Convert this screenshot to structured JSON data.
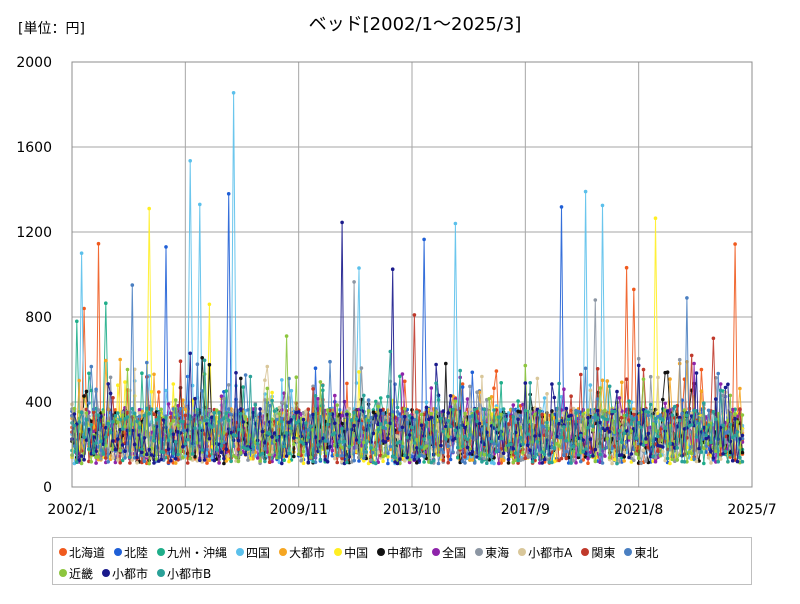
{
  "chart_data": {
    "type": "line",
    "title": "ベッド[2002/1～2025/3]",
    "unit_label": "[単位：円]",
    "ylim": [
      0,
      2000
    ],
    "yticks": [
      "0",
      "400",
      "800",
      "1200",
      "1600",
      "2000"
    ],
    "xticks": [
      "2002/1",
      "2005/12",
      "2009/11",
      "2013/10",
      "2017/9",
      "2021/8",
      "2025/7"
    ],
    "x_start": "2002/1",
    "x_end": "2025/7",
    "grid": true,
    "legend_position": "bottom",
    "series": [
      {
        "name": "北海道",
        "color": "#f05a1e",
        "peaks": [
          [
            "2002/12",
            1145
          ],
          [
            "2002/6",
            840
          ],
          [
            "2024/12",
            1143
          ],
          [
            "2021/3",
            1032
          ],
          [
            "2021/6",
            930
          ]
        ]
      },
      {
        "name": "北陸",
        "color": "#1f5fd6",
        "peaks": [
          [
            "2007/6",
            1380
          ],
          [
            "2018/12",
            1318
          ],
          [
            "2005/4",
            1130
          ],
          [
            "2014/3",
            1165
          ]
        ]
      },
      {
        "name": "九州・沖縄",
        "color": "#1fae8a",
        "peaks": [
          [
            "2002/3",
            780
          ],
          [
            "2003/3",
            865
          ]
        ]
      },
      {
        "name": "四国",
        "color": "#5bc0eb",
        "peaks": [
          [
            "2007/8",
            1855
          ],
          [
            "2006/2",
            1535
          ],
          [
            "2006/6",
            1330
          ],
          [
            "2019/10",
            1390
          ],
          [
            "2020/5",
            1325
          ],
          [
            "2002/5",
            1100
          ],
          [
            "2015/4",
            1240
          ],
          [
            "2011/12",
            1030
          ]
        ]
      },
      {
        "name": "大都市",
        "color": "#f5a623",
        "peaks": [
          [
            "2003/9",
            600
          ]
        ]
      },
      {
        "name": "中国",
        "color": "#ffee22",
        "peaks": [
          [
            "2004/9",
            1310
          ],
          [
            "2022/3",
            1265
          ],
          [
            "2006/10",
            860
          ]
        ]
      },
      {
        "name": "中都市",
        "color": "#111111",
        "peaks": [
          [
            "2002/7",
            450
          ]
        ]
      },
      {
        "name": "全国",
        "color": "#8e24aa",
        "peaks": [
          [
            "2011/2",
            430
          ]
        ]
      },
      {
        "name": "東海",
        "color": "#8c96a3",
        "peaks": [
          [
            "2011/10",
            965
          ],
          [
            "2020/2",
            880
          ]
        ]
      },
      {
        "name": "小都市A",
        "color": "#d9c79a",
        "peaks": [
          [
            "2016/3",
            520
          ]
        ]
      },
      {
        "name": "関東",
        "color": "#c0392b",
        "peaks": [
          [
            "2013/11",
            810
          ],
          [
            "2024/3",
            700
          ]
        ]
      },
      {
        "name": "東北",
        "color": "#4a7fc1",
        "peaks": [
          [
            "2004/2",
            950
          ],
          [
            "2023/4",
            890
          ]
        ]
      },
      {
        "name": "近畿",
        "color": "#8dc63f",
        "peaks": [
          [
            "2009/6",
            710
          ]
        ]
      },
      {
        "name": "小都市",
        "color": "#1a1a8c",
        "peaks": [
          [
            "2011/5",
            1245
          ],
          [
            "2013/2",
            1025
          ]
        ]
      },
      {
        "name": "小都市B",
        "color": "#2aa198",
        "peaks": [
          [
            "2008/3",
            520
          ]
        ]
      }
    ]
  }
}
